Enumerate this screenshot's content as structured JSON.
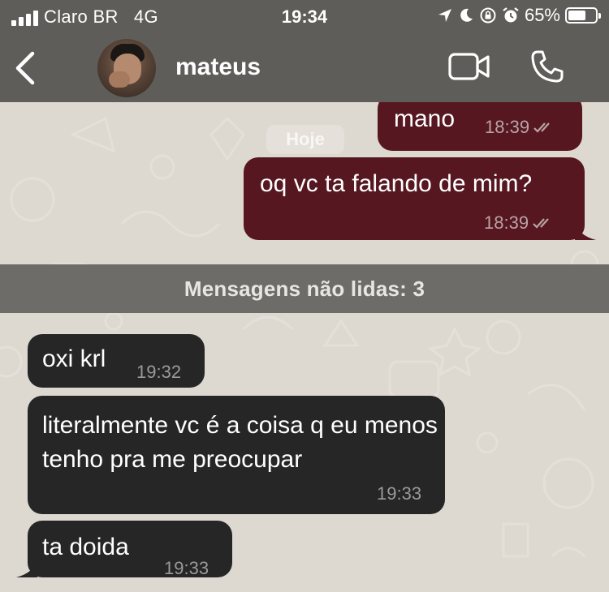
{
  "status_bar": {
    "carrier": "Claro BR",
    "network": "4G",
    "time": "19:34",
    "battery_percent": "65%",
    "battery_level": 0.65
  },
  "header": {
    "contact_name": "mateus",
    "icons": [
      "back-chevron-icon",
      "video-call-icon",
      "phone-icon"
    ]
  },
  "chat": {
    "date_label": "Hoje",
    "unread_label": "Mensagens não lidas: 3",
    "outgoing": [
      {
        "text": "mano",
        "time": "18:39"
      },
      {
        "text": "oq vc ta falando de mim?",
        "time": "18:39"
      }
    ],
    "incoming": [
      {
        "text": "oxi krl",
        "time": "19:32"
      },
      {
        "text": "literalmente vc é a coisa q eu menos tenho pra me preocupar",
        "time": "19:33"
      },
      {
        "text": "ta doida",
        "time": "19:33"
      }
    ]
  },
  "colors": {
    "outgoing_bubble": "#561721",
    "incoming_bubble": "#262626",
    "header_bg": "#5f5d5a",
    "chat_bg": "#ddd8d0"
  }
}
